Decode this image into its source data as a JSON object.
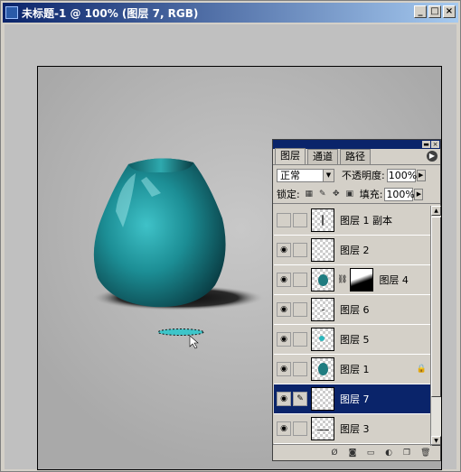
{
  "window": {
    "title": "未标题-1 @ 100% (图层 7, RGB)",
    "buttons": {
      "minimize": "_",
      "maximize": "□",
      "close": "×"
    }
  },
  "layers_panel": {
    "tabs": [
      {
        "label": "图层",
        "active": true
      },
      {
        "label": "通道",
        "active": false
      },
      {
        "label": "路径",
        "active": false
      }
    ],
    "blend_mode": "正常",
    "opacity_label": "不透明度:",
    "opacity_value": "100%",
    "lock_label": "锁定:",
    "fill_label": "填充:",
    "fill_value": "100%",
    "layers": [
      {
        "name": "图层 1 副本",
        "visible": false,
        "selected": false
      },
      {
        "name": "图层 2",
        "visible": true,
        "selected": false
      },
      {
        "name": "图层 4",
        "visible": true,
        "selected": false,
        "has_mask": true
      },
      {
        "name": "图层 6",
        "visible": true,
        "selected": false
      },
      {
        "name": "图层 5",
        "visible": true,
        "selected": false
      },
      {
        "name": "图层 1",
        "visible": true,
        "selected": false,
        "locked": true
      },
      {
        "name": "图层 7",
        "visible": true,
        "selected": true,
        "brush": true
      },
      {
        "name": "图层 3",
        "visible": true,
        "selected": false
      }
    ]
  },
  "colors": {
    "title_bar": "#0a246a",
    "selection": "#0a246a",
    "vase": "#1f8a90",
    "canvas_bg": "#b3b3b3"
  }
}
